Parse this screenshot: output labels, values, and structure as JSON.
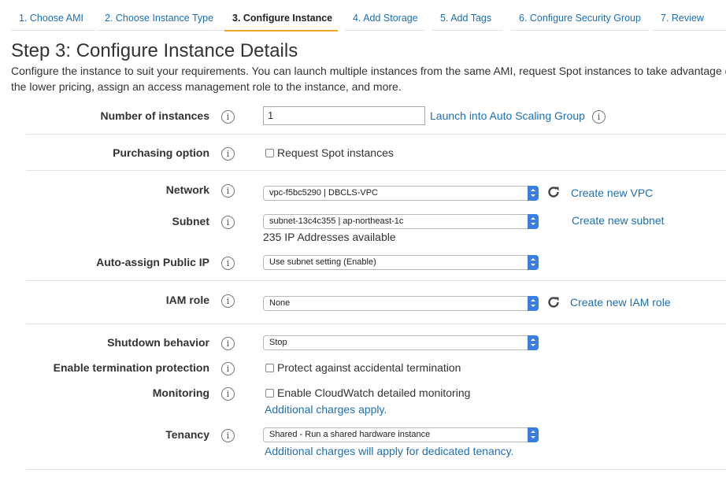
{
  "tabs": [
    {
      "label": "1. Choose AMI",
      "active": false
    },
    {
      "label": "2. Choose Instance Type",
      "active": false
    },
    {
      "label": "3. Configure Instance",
      "active": true
    },
    {
      "label": "4. Add Storage",
      "active": false
    },
    {
      "label": "5. Add Tags",
      "active": false
    },
    {
      "label": "6. Configure Security Group",
      "active": false
    },
    {
      "label": "7. Review",
      "active": false
    }
  ],
  "page": {
    "title": "Step 3: Configure Instance Details",
    "description": "Configure the instance to suit your requirements. You can launch multiple instances from the same AMI, request Spot instances to take advantage of the lower pricing, assign an access management role to the instance, and more."
  },
  "form": {
    "number_of_instances": {
      "label": "Number of instances",
      "value": "1",
      "link": "Launch into Auto Scaling Group"
    },
    "purchasing_option": {
      "label": "Purchasing option",
      "checkbox_label": "Request Spot instances",
      "checked": false
    },
    "network": {
      "label": "Network",
      "value": "vpc-f5bc5290 | DBCLS-VPC",
      "link": "Create new VPC"
    },
    "subnet": {
      "label": "Subnet",
      "value": "subnet-13c4c355 | ap-northeast-1c",
      "note": "235 IP Addresses available",
      "link": "Create new subnet"
    },
    "auto_assign_ip": {
      "label": "Auto-assign Public IP",
      "value": "Use subnet setting (Enable)"
    },
    "iam_role": {
      "label": "IAM role",
      "value": "None",
      "link": "Create new IAM role"
    },
    "shutdown": {
      "label": "Shutdown behavior",
      "value": "Stop"
    },
    "termination": {
      "label": "Enable termination protection",
      "checkbox_label": "Protect against accidental termination",
      "checked": false
    },
    "monitoring": {
      "label": "Monitoring",
      "checkbox_label": "Enable CloudWatch detailed monitoring",
      "checked": false,
      "note_link": "Additional charges apply."
    },
    "tenancy": {
      "label": "Tenancy",
      "value": "Shared - Run a shared hardware instance",
      "note_link": "Additional charges will apply for dedicated tenancy."
    }
  },
  "info_glyph": "i",
  "colors": {
    "link": "#1e6fb0",
    "active_tab_underline": "#f0a31e",
    "select_arrow": "#3a7ee0"
  },
  "icons": {
    "refresh": "refresh-icon",
    "info": "info-icon"
  }
}
